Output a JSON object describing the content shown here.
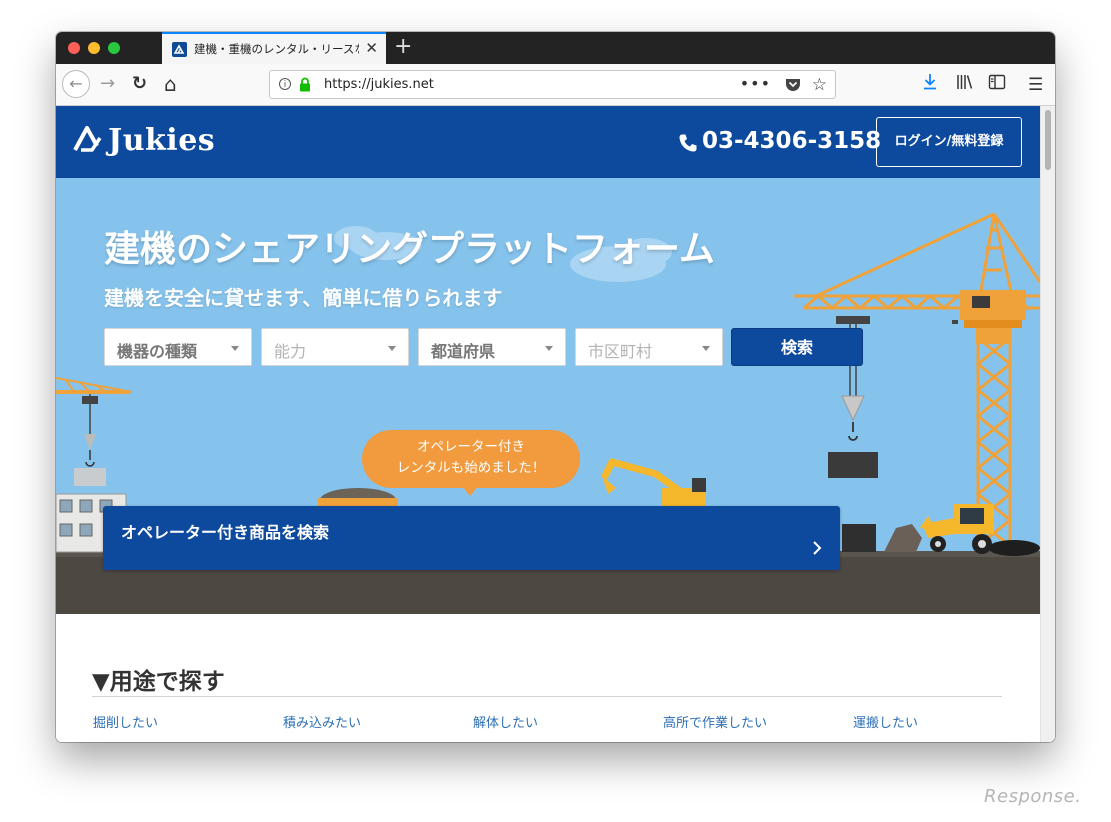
{
  "browser": {
    "tab_title": "建機・重機のレンタル・リースな",
    "tab_close": "✕",
    "new_tab": "+",
    "url": "https://jukies.net",
    "url_more": "•••",
    "url_star": "☆",
    "nav_back": "←",
    "nav_forward": "→",
    "nav_reload": "↻",
    "nav_home": "⌂",
    "menu": "☰"
  },
  "header": {
    "logo": "Jukies",
    "phone": "03-4306-3158",
    "login_label": "ログイン/無料登録"
  },
  "hero": {
    "title": "建機のシェアリングプラットフォーム",
    "subtitle": "建機を安全に貸せます、簡単に借りられます",
    "filters": [
      {
        "label": "機器の種類"
      },
      {
        "label": "能力"
      },
      {
        "label": "都道府県"
      },
      {
        "label": "市区町村"
      }
    ],
    "search_label": "検索",
    "bubble_line1": "オペレーター付き",
    "bubble_line2": "レンタルも始めました！",
    "operator_search_label": "オペレーター付き商品を検索"
  },
  "usage": {
    "heading": "▼用途で探す",
    "links": [
      "掘削したい",
      "積み込みたい",
      "解体したい",
      "高所で作業したい",
      "運搬したい"
    ]
  },
  "watermark": "Response.",
  "colors": {
    "brand_blue": "#0d4a9e",
    "sky": "#86c3ec",
    "crane_orange": "#f0a23a",
    "bubble_orange": "#f19a3e",
    "ground": "#4e4843",
    "link": "#2d6fb5"
  }
}
